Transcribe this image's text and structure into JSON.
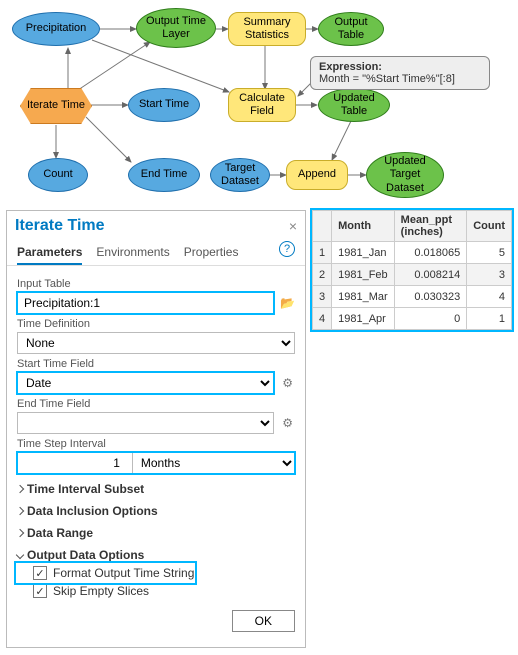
{
  "model": {
    "nodes": {
      "precipitation": "Precipitation",
      "output_time_layer": "Output Time Layer",
      "summary_stats": "Summary Statistics",
      "output_table": "Output Table",
      "iterate_time": "Iterate Time",
      "start_time": "Start Time",
      "calculate_field": "Calculate Field",
      "updated_table": "Updated Table",
      "count": "Count",
      "end_time": "End Time",
      "target_dataset": "Target Dataset",
      "append": "Append",
      "updated_target_dataset": "Updated Target Dataset"
    },
    "callout": {
      "title": "Expression:",
      "body": "Month = \"%Start Time%\"[:8]"
    }
  },
  "panel": {
    "title": "Iterate Time",
    "close": "×",
    "tabs": [
      "Parameters",
      "Environments",
      "Properties"
    ],
    "help": "?",
    "labels": {
      "input_table": "Input Table",
      "time_definition": "Time Definition",
      "start_time_field": "Start Time Field",
      "end_time_field": "End Time Field",
      "time_step_interval": "Time Step Interval"
    },
    "values": {
      "input_table": "Precipitation:1",
      "time_definition": "None",
      "start_time_field": "Date",
      "end_time_field": "",
      "time_step_value": "1",
      "time_step_unit": "Months"
    },
    "groups": {
      "time_interval_subset": "Time Interval Subset",
      "data_inclusion_options": "Data Inclusion Options",
      "data_range": "Data Range",
      "output_data_options": "Output Data Options"
    },
    "checkboxes": {
      "format_output_time_string": "Format Output Time String",
      "skip_empty_slices": "Skip Empty Slices"
    },
    "ok": "OK"
  },
  "table": {
    "columns": [
      "Month",
      "Mean_ppt (inches)",
      "Count"
    ],
    "rows": [
      {
        "n": "1",
        "month": "1981_Jan",
        "mean": "0.018065",
        "count": "5"
      },
      {
        "n": "2",
        "month": "1981_Feb",
        "mean": "0.008214",
        "count": "3"
      },
      {
        "n": "3",
        "month": "1981_Mar",
        "mean": "0.030323",
        "count": "4"
      },
      {
        "n": "4",
        "month": "1981_Apr",
        "mean": "0",
        "count": "1"
      }
    ]
  }
}
